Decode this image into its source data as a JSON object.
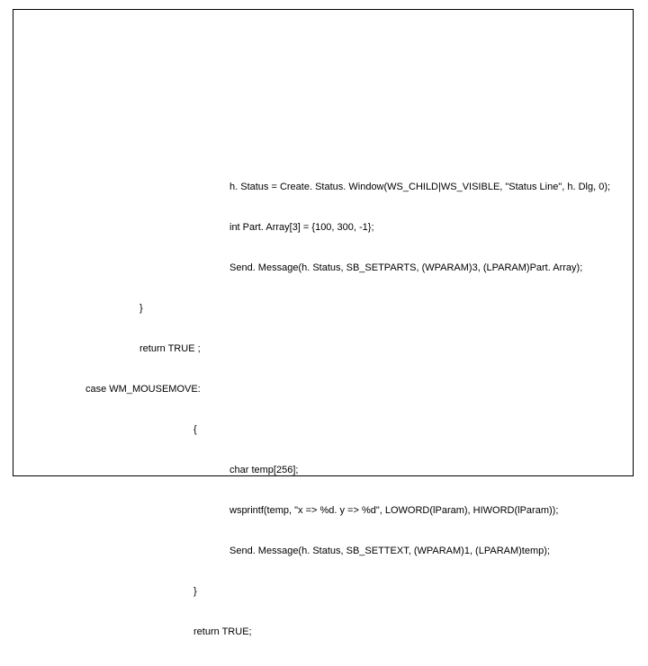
{
  "code": {
    "l1": "h. Status = Create. Status. Window(WS_CHILD|WS_VISIBLE, \"Status Line\", h. Dlg, 0);",
    "l2": "int Part. Array[3] = {100, 300, -1};",
    "l3": "Send. Message(h. Status, SB_SETPARTS, (WPARAM)3, (LPARAM)Part. Array);",
    "l4": "}",
    "l5": "return TRUE ;",
    "l6": "case WM_MOUSEMOVE:",
    "l7": "{",
    "l8": "char temp[256];",
    "l9": "wsprintf(temp, \"x => %d. y => %d\", LOWORD(lParam), HIWORD(lParam));",
    "l10": "Send. Message(h. Status, SB_SETTEXT, (WPARAM)1, (LPARAM)temp);",
    "l11": "}",
    "l12": "return TRUE;"
  }
}
